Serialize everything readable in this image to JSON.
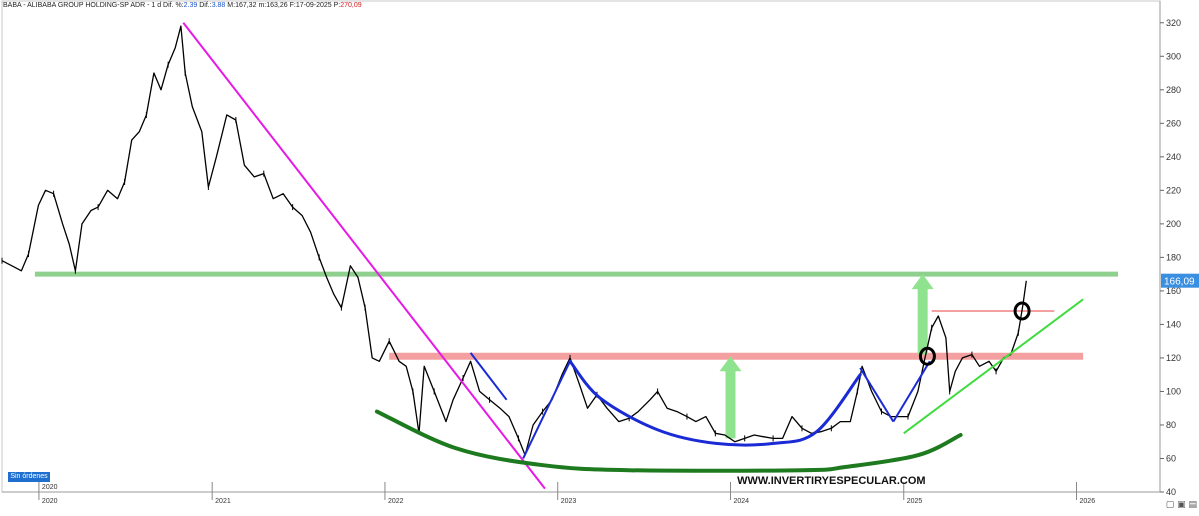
{
  "header": {
    "symbol": "BABA - ALIBABA GROUP HOLDING-SP ADR -",
    "timeframe": "1 d",
    "dif_pct_label": "Dif. %:",
    "dif_pct_value": "2.39",
    "dif_label": "Dif.:",
    "dif_value": "3.88",
    "max_label": "M:",
    "max_value": "167,32",
    "min_label": "m:",
    "min_value": "163,26",
    "date_label": "F:",
    "date_value": "17-09-2025",
    "p_label": "P:",
    "p_value": "270,09"
  },
  "badge": {
    "label": "Sin órdenes"
  },
  "watermark": "WWW.INVERTIRYESPECULAR.COM",
  "colors": {
    "price": "#000000",
    "resistance_green": "#8fd08f",
    "neckline_red": "#f4a0a0",
    "downtrend_magenta": "#e619e6",
    "cup_blue": "#1a2bd6",
    "base_dark_green": "#1e7a1e",
    "uptrend_green": "#3fdc3f",
    "arrow_green": "#8fe38f",
    "price_tag_blue": "#3a8fe0"
  },
  "chart_data": {
    "type": "line",
    "title": "",
    "xlabel": "",
    "ylabel": "",
    "ylim": [
      40,
      330
    ],
    "y_ticks": [
      40,
      60,
      80,
      100,
      120,
      140,
      160,
      180,
      200,
      220,
      240,
      260,
      280,
      300,
      320
    ],
    "x_tick_labels": [
      "2020",
      "2021",
      "2022",
      "2023",
      "2024",
      "2025",
      "2026"
    ],
    "x_tick_dates": [
      "2020-01-01",
      "2021-01-01",
      "2022-01-01",
      "2023-01-01",
      "2024-01-01",
      "2025-01-01",
      "2026-01-01"
    ],
    "xlim": [
      "2019-10-15",
      "2026-06-01"
    ],
    "last_price_label": "166,09",
    "last_price": 166.09,
    "grid": false,
    "series": [
      {
        "points": [
          [
            "2019-10-15",
            178
          ],
          [
            "2019-11-05",
            175
          ],
          [
            "2019-11-25",
            172
          ],
          [
            "2019-12-10",
            182
          ],
          [
            "2019-12-31",
            211
          ],
          [
            "2020-01-15",
            220
          ],
          [
            "2020-02-01",
            218
          ],
          [
            "2020-02-20",
            200
          ],
          [
            "2020-03-05",
            188
          ],
          [
            "2020-03-18",
            172
          ],
          [
            "2020-04-01",
            200
          ],
          [
            "2020-04-20",
            208
          ],
          [
            "2020-05-05",
            210
          ],
          [
            "2020-05-25",
            220
          ],
          [
            "2020-06-15",
            215
          ],
          [
            "2020-06-30",
            225
          ],
          [
            "2020-07-15",
            250
          ],
          [
            "2020-07-31",
            255
          ],
          [
            "2020-08-15",
            265
          ],
          [
            "2020-08-31",
            290
          ],
          [
            "2020-09-15",
            280
          ],
          [
            "2020-09-30",
            295
          ],
          [
            "2020-10-15",
            305
          ],
          [
            "2020-10-27",
            318
          ],
          [
            "2020-11-05",
            290
          ],
          [
            "2020-11-20",
            270
          ],
          [
            "2020-12-10",
            255
          ],
          [
            "2020-12-24",
            222
          ],
          [
            "2021-01-10",
            240
          ],
          [
            "2021-02-01",
            265
          ],
          [
            "2021-02-20",
            262
          ],
          [
            "2021-03-10",
            235
          ],
          [
            "2021-03-31",
            228
          ],
          [
            "2021-04-20",
            230
          ],
          [
            "2021-05-10",
            215
          ],
          [
            "2021-05-31",
            218
          ],
          [
            "2021-06-20",
            210
          ],
          [
            "2021-07-10",
            205
          ],
          [
            "2021-07-28",
            195
          ],
          [
            "2021-08-15",
            180
          ],
          [
            "2021-08-31",
            168
          ],
          [
            "2021-09-15",
            158
          ],
          [
            "2021-10-01",
            150
          ],
          [
            "2021-10-20",
            175
          ],
          [
            "2021-11-05",
            168
          ],
          [
            "2021-11-20",
            150
          ],
          [
            "2021-12-05",
            120
          ],
          [
            "2021-12-20",
            118
          ],
          [
            "2022-01-10",
            130
          ],
          [
            "2022-01-31",
            118
          ],
          [
            "2022-02-15",
            115
          ],
          [
            "2022-03-01",
            100
          ],
          [
            "2022-03-14",
            75
          ],
          [
            "2022-03-25",
            115
          ],
          [
            "2022-04-15",
            100
          ],
          [
            "2022-05-10",
            82
          ],
          [
            "2022-05-25",
            95
          ],
          [
            "2022-06-15",
            108
          ],
          [
            "2022-07-01",
            118
          ],
          [
            "2022-07-20",
            100
          ],
          [
            "2022-08-10",
            95
          ],
          [
            "2022-09-01",
            90
          ],
          [
            "2022-09-20",
            85
          ],
          [
            "2022-10-10",
            72
          ],
          [
            "2022-10-24",
            62
          ],
          [
            "2022-11-10",
            80
          ],
          [
            "2022-11-30",
            88
          ],
          [
            "2022-12-20",
            95
          ],
          [
            "2023-01-10",
            110
          ],
          [
            "2023-01-27",
            120
          ],
          [
            "2023-02-15",
            105
          ],
          [
            "2023-03-05",
            90
          ],
          [
            "2023-03-25",
            98
          ],
          [
            "2023-04-15",
            90
          ],
          [
            "2023-05-10",
            82
          ],
          [
            "2023-06-01",
            84
          ],
          [
            "2023-06-20",
            88
          ],
          [
            "2023-07-15",
            95
          ],
          [
            "2023-07-31",
            100
          ],
          [
            "2023-08-20",
            90
          ],
          [
            "2023-09-10",
            88
          ],
          [
            "2023-10-01",
            85
          ],
          [
            "2023-10-20",
            82
          ],
          [
            "2023-11-10",
            85
          ],
          [
            "2023-11-30",
            75
          ],
          [
            "2023-12-20",
            74
          ],
          [
            "2024-01-10",
            70
          ],
          [
            "2024-01-31",
            72
          ],
          [
            "2024-02-20",
            74
          ],
          [
            "2024-03-10",
            73
          ],
          [
            "2024-03-31",
            72
          ],
          [
            "2024-04-20",
            72
          ],
          [
            "2024-05-10",
            85
          ],
          [
            "2024-05-31",
            78
          ],
          [
            "2024-06-20",
            75
          ],
          [
            "2024-07-10",
            76
          ],
          [
            "2024-08-01",
            78
          ],
          [
            "2024-08-20",
            82
          ],
          [
            "2024-09-10",
            82
          ],
          [
            "2024-09-25",
            100
          ],
          [
            "2024-10-05",
            115
          ],
          [
            "2024-10-25",
            100
          ],
          [
            "2024-11-15",
            88
          ],
          [
            "2024-12-05",
            85
          ],
          [
            "2024-12-20",
            85
          ],
          [
            "2025-01-10",
            85
          ],
          [
            "2025-01-31",
            100
          ],
          [
            "2025-02-15",
            120
          ],
          [
            "2025-03-01",
            138
          ],
          [
            "2025-03-15",
            145
          ],
          [
            "2025-03-31",
            132
          ],
          [
            "2025-04-08",
            100
          ],
          [
            "2025-04-20",
            112
          ],
          [
            "2025-05-05",
            120
          ],
          [
            "2025-05-25",
            122
          ],
          [
            "2025-06-10",
            115
          ],
          [
            "2025-06-30",
            118
          ],
          [
            "2025-07-15",
            112
          ],
          [
            "2025-07-31",
            120
          ],
          [
            "2025-08-15",
            122
          ],
          [
            "2025-08-31",
            135
          ],
          [
            "2025-09-10",
            152
          ],
          [
            "2025-09-17",
            166
          ]
        ]
      }
    ],
    "annotations": {
      "resistance_level": 170,
      "neckline_level": 121,
      "downtrend_line": [
        [
          "2020-11-01",
          320
        ],
        [
          "2022-12-05",
          42
        ]
      ],
      "target_line": {
        "from": "2025-03-01",
        "to": "2025-11-15",
        "y": 148
      },
      "uptrend_line": [
        [
          "2025-01-01",
          75
        ],
        [
          "2026-01-15",
          155
        ]
      ],
      "base_curve": [
        [
          "2021-12-15",
          88
        ],
        [
          "2022-06-01",
          66
        ],
        [
          "2022-12-01",
          56
        ],
        [
          "2023-06-01",
          53
        ],
        [
          "2024-06-01",
          53
        ],
        [
          "2024-09-01",
          55
        ],
        [
          "2025-02-01",
          62
        ],
        [
          "2025-05-01",
          74
        ]
      ],
      "cup_curve": [
        [
          "2023-01-27",
          118
        ],
        [
          "2023-04-01",
          96
        ],
        [
          "2023-08-01",
          77
        ],
        [
          "2023-12-01",
          69
        ],
        [
          "2024-04-01",
          69
        ],
        [
          "2024-07-01",
          76
        ],
        [
          "2024-10-01",
          110
        ]
      ],
      "blue_segments": [
        [
          [
            "2022-07-01",
            123
          ],
          [
            "2022-09-15",
            95
          ]
        ],
        [
          [
            "2022-10-20",
            60
          ],
          [
            "2023-01-27",
            118
          ]
        ],
        [
          [
            "2024-10-01",
            114
          ],
          [
            "2024-12-10",
            82
          ]
        ],
        [
          [
            "2024-12-10",
            82
          ],
          [
            "2025-02-25",
            118
          ]
        ]
      ],
      "up_arrows": [
        {
          "date": "2024-01-01",
          "from": 72,
          "to": 121
        },
        {
          "date": "2025-02-10",
          "from": 122,
          "to": 170
        }
      ],
      "circles": [
        {
          "date": "2025-02-20",
          "value": 121
        },
        {
          "date": "2025-09-08",
          "value": 148
        }
      ]
    }
  }
}
